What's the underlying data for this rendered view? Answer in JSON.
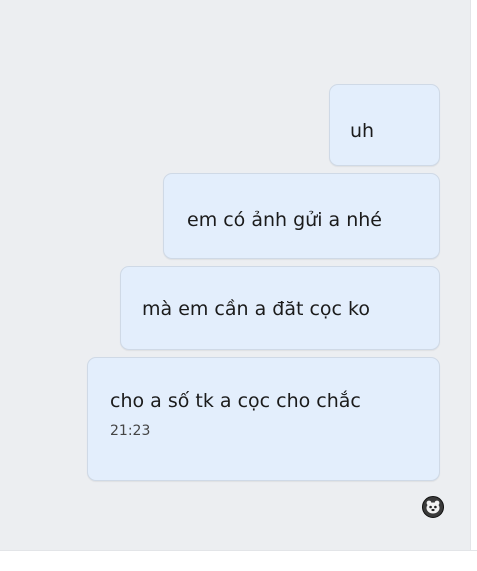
{
  "messages": [
    {
      "text": "uh"
    },
    {
      "text": "em có ảnh gửi a nhé"
    },
    {
      "text": "mà em cần a đăt cọc ko"
    },
    {
      "text": "cho a số tk a cọc cho chắc",
      "time": "21:23"
    }
  ],
  "seen_avatar": {
    "icon": "avatar-icon"
  },
  "colors": {
    "chat_background": "#eceef1",
    "bubble_background": "#e3eefc",
    "bubble_border": "#cfd9e6"
  }
}
